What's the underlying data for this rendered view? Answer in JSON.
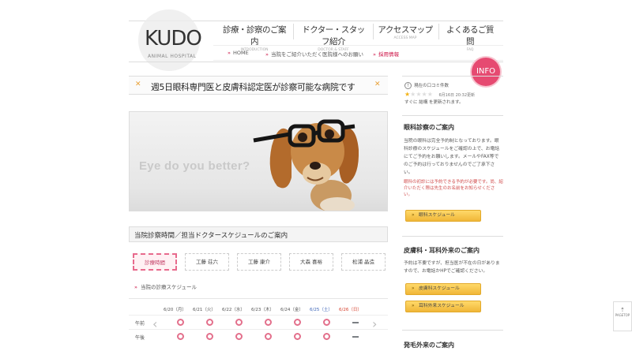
{
  "logo": {
    "name": "KUDO",
    "sub": "ANIMAL HOSPITAL"
  },
  "nav": [
    {
      "jp": "診療・診察のご案内",
      "en": "INTRODUCTION"
    },
    {
      "jp": "ドクター・スタッフ紹介",
      "en": "DOCTOR & STAFF"
    },
    {
      "jp": "アクセスマップ",
      "en": "ACCESS MAP"
    },
    {
      "jp": "よくあるご質問",
      "en": "FAQ"
    }
  ],
  "subnav": {
    "home": "HOME",
    "referral": "当院をご紹介いただく医院様へのお願い",
    "recruit": "採用情報"
  },
  "info_badge": "INFO",
  "headline": "週5日眼科専門医と皮膚科認定医が診察可能な病院です",
  "hero": {
    "text": "Eye do you better?"
  },
  "schedule": {
    "title": "当院診察時間／担当ドクタースケジュールのご案内",
    "doctors": [
      "診療時間",
      "工藤 荘六",
      "工藤 康介",
      "大森 喜裕",
      "松浦 晶造"
    ],
    "legend": "当院の診療スケジュール",
    "days": [
      "6/20（月）",
      "6/21（火）",
      "6/22（水）",
      "6/23（木）",
      "6/24（金）",
      "6/25（土）",
      "6/26（日）"
    ],
    "rows": [
      "午前",
      "午後"
    ]
  },
  "sidebar": {
    "review": {
      "title": "現在の口コミ件数",
      "date": "6月16日 20:32更新",
      "text": "すぐに 結構 を更新されます。",
      "stars_filled": 1,
      "stars_total": 5
    },
    "eye": {
      "title": "眼科診察のご案内",
      "text": "当院の眼科は完全予約制となっております。眼科診療のスケジュールをご確認の上で、お電話にてご予約をお願いします。メールやFAX等でのご予約は行っておりませんのでご了承下さい。",
      "note": "眼科の初診には予約できる予約が必要です。尚、紹介いただく際は先生のお名前をお知らせください。",
      "button": "眼科スケジュール"
    },
    "derm": {
      "title": "皮膚科・耳科外来のご案内",
      "text": "予約は不要ですが、担当医が不在の日がありますので、お電話かHPでご確認ください。",
      "buttons": [
        "皮膚科スケジュール",
        "耳科外来スケジュール"
      ]
    },
    "hair": {
      "title": "発毛外来のご案内"
    }
  },
  "pagetop": "PAGETOP",
  "colors": {
    "accent": "#e64a71",
    "button": "#f0b638",
    "circle": "#e3708c"
  },
  "icons": [
    "warning-icon",
    "star-icon",
    "chevron-left-icon",
    "chevron-right-icon",
    "arrow-up-icon"
  ]
}
